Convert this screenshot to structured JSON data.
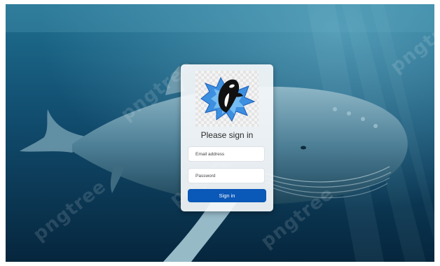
{
  "background": {
    "image": "humpback-whale-underwater",
    "watermark_text": "pngtree"
  },
  "login": {
    "logo_icon": "orca-splash-icon",
    "heading": "Please sign in",
    "email_placeholder": "Email address",
    "password_placeholder": "Password",
    "submit_label": "Sign in",
    "accent_color": "#0a58b8"
  }
}
